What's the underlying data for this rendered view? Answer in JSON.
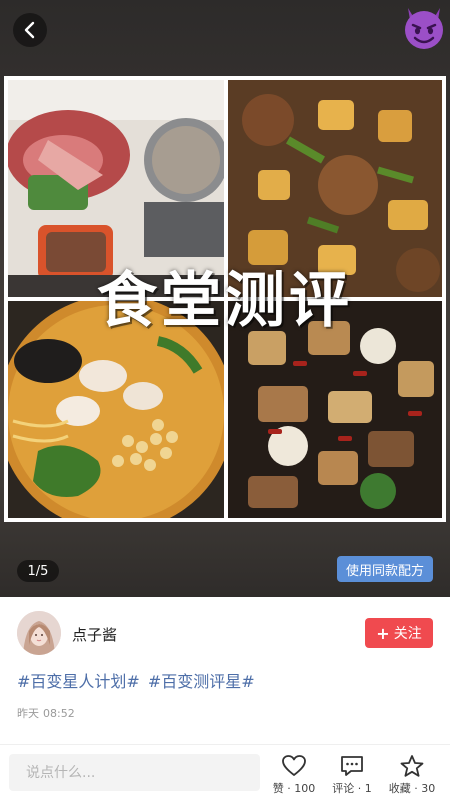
{
  "gallery": {
    "overlay_title": "食堂测评",
    "page_indicator": "1/5",
    "recipe_button": "使用同款配方"
  },
  "author": {
    "name": "点子酱",
    "follow_label": "关注"
  },
  "post": {
    "hashtags": [
      "#百变星人计划#",
      "#百变测评星#"
    ],
    "time_day": "昨天",
    "time_clock": "08:52"
  },
  "bottom_bar": {
    "comment_placeholder": "说点什么...",
    "like_label": "赞 · 100",
    "comment_label": "评论 · 1",
    "favorite_label": "收藏 · 30"
  },
  "icons": {
    "back": "chevron-left-icon",
    "badge": "devil-emoji-icon",
    "follow": "plus-icon",
    "like": "heart-icon",
    "comment": "comment-icon",
    "favorite": "star-icon"
  },
  "colors": {
    "follow_button": "#f04a4f",
    "recipe_button": "#5b8fd8",
    "hashtag": "#4d6ea8"
  }
}
